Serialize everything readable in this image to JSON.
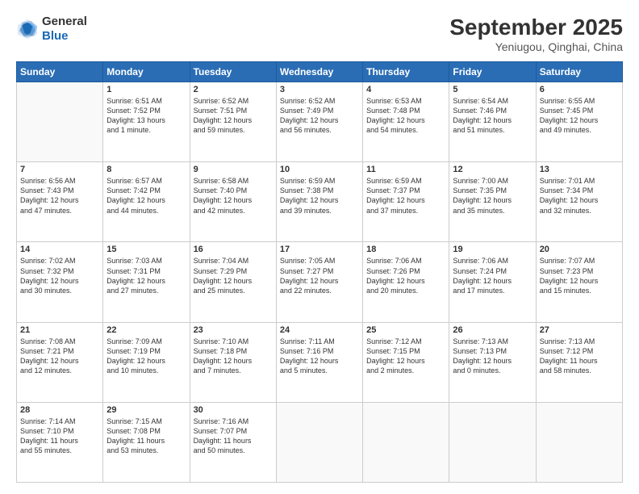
{
  "header": {
    "logo_general": "General",
    "logo_blue": "Blue",
    "month_title": "September 2025",
    "location": "Yeniugou, Qinghai, China"
  },
  "days_header": [
    "Sunday",
    "Monday",
    "Tuesday",
    "Wednesday",
    "Thursday",
    "Friday",
    "Saturday"
  ],
  "weeks": [
    [
      {
        "day": "",
        "lines": []
      },
      {
        "day": "1",
        "lines": [
          "Sunrise: 6:51 AM",
          "Sunset: 7:52 PM",
          "Daylight: 13 hours",
          "and 1 minute."
        ]
      },
      {
        "day": "2",
        "lines": [
          "Sunrise: 6:52 AM",
          "Sunset: 7:51 PM",
          "Daylight: 12 hours",
          "and 59 minutes."
        ]
      },
      {
        "day": "3",
        "lines": [
          "Sunrise: 6:52 AM",
          "Sunset: 7:49 PM",
          "Daylight: 12 hours",
          "and 56 minutes."
        ]
      },
      {
        "day": "4",
        "lines": [
          "Sunrise: 6:53 AM",
          "Sunset: 7:48 PM",
          "Daylight: 12 hours",
          "and 54 minutes."
        ]
      },
      {
        "day": "5",
        "lines": [
          "Sunrise: 6:54 AM",
          "Sunset: 7:46 PM",
          "Daylight: 12 hours",
          "and 51 minutes."
        ]
      },
      {
        "day": "6",
        "lines": [
          "Sunrise: 6:55 AM",
          "Sunset: 7:45 PM",
          "Daylight: 12 hours",
          "and 49 minutes."
        ]
      }
    ],
    [
      {
        "day": "7",
        "lines": [
          "Sunrise: 6:56 AM",
          "Sunset: 7:43 PM",
          "Daylight: 12 hours",
          "and 47 minutes."
        ]
      },
      {
        "day": "8",
        "lines": [
          "Sunrise: 6:57 AM",
          "Sunset: 7:42 PM",
          "Daylight: 12 hours",
          "and 44 minutes."
        ]
      },
      {
        "day": "9",
        "lines": [
          "Sunrise: 6:58 AM",
          "Sunset: 7:40 PM",
          "Daylight: 12 hours",
          "and 42 minutes."
        ]
      },
      {
        "day": "10",
        "lines": [
          "Sunrise: 6:59 AM",
          "Sunset: 7:38 PM",
          "Daylight: 12 hours",
          "and 39 minutes."
        ]
      },
      {
        "day": "11",
        "lines": [
          "Sunrise: 6:59 AM",
          "Sunset: 7:37 PM",
          "Daylight: 12 hours",
          "and 37 minutes."
        ]
      },
      {
        "day": "12",
        "lines": [
          "Sunrise: 7:00 AM",
          "Sunset: 7:35 PM",
          "Daylight: 12 hours",
          "and 35 minutes."
        ]
      },
      {
        "day": "13",
        "lines": [
          "Sunrise: 7:01 AM",
          "Sunset: 7:34 PM",
          "Daylight: 12 hours",
          "and 32 minutes."
        ]
      }
    ],
    [
      {
        "day": "14",
        "lines": [
          "Sunrise: 7:02 AM",
          "Sunset: 7:32 PM",
          "Daylight: 12 hours",
          "and 30 minutes."
        ]
      },
      {
        "day": "15",
        "lines": [
          "Sunrise: 7:03 AM",
          "Sunset: 7:31 PM",
          "Daylight: 12 hours",
          "and 27 minutes."
        ]
      },
      {
        "day": "16",
        "lines": [
          "Sunrise: 7:04 AM",
          "Sunset: 7:29 PM",
          "Daylight: 12 hours",
          "and 25 minutes."
        ]
      },
      {
        "day": "17",
        "lines": [
          "Sunrise: 7:05 AM",
          "Sunset: 7:27 PM",
          "Daylight: 12 hours",
          "and 22 minutes."
        ]
      },
      {
        "day": "18",
        "lines": [
          "Sunrise: 7:06 AM",
          "Sunset: 7:26 PM",
          "Daylight: 12 hours",
          "and 20 minutes."
        ]
      },
      {
        "day": "19",
        "lines": [
          "Sunrise: 7:06 AM",
          "Sunset: 7:24 PM",
          "Daylight: 12 hours",
          "and 17 minutes."
        ]
      },
      {
        "day": "20",
        "lines": [
          "Sunrise: 7:07 AM",
          "Sunset: 7:23 PM",
          "Daylight: 12 hours",
          "and 15 minutes."
        ]
      }
    ],
    [
      {
        "day": "21",
        "lines": [
          "Sunrise: 7:08 AM",
          "Sunset: 7:21 PM",
          "Daylight: 12 hours",
          "and 12 minutes."
        ]
      },
      {
        "day": "22",
        "lines": [
          "Sunrise: 7:09 AM",
          "Sunset: 7:19 PM",
          "Daylight: 12 hours",
          "and 10 minutes."
        ]
      },
      {
        "day": "23",
        "lines": [
          "Sunrise: 7:10 AM",
          "Sunset: 7:18 PM",
          "Daylight: 12 hours",
          "and 7 minutes."
        ]
      },
      {
        "day": "24",
        "lines": [
          "Sunrise: 7:11 AM",
          "Sunset: 7:16 PM",
          "Daylight: 12 hours",
          "and 5 minutes."
        ]
      },
      {
        "day": "25",
        "lines": [
          "Sunrise: 7:12 AM",
          "Sunset: 7:15 PM",
          "Daylight: 12 hours",
          "and 2 minutes."
        ]
      },
      {
        "day": "26",
        "lines": [
          "Sunrise: 7:13 AM",
          "Sunset: 7:13 PM",
          "Daylight: 12 hours",
          "and 0 minutes."
        ]
      },
      {
        "day": "27",
        "lines": [
          "Sunrise: 7:13 AM",
          "Sunset: 7:12 PM",
          "Daylight: 11 hours",
          "and 58 minutes."
        ]
      }
    ],
    [
      {
        "day": "28",
        "lines": [
          "Sunrise: 7:14 AM",
          "Sunset: 7:10 PM",
          "Daylight: 11 hours",
          "and 55 minutes."
        ]
      },
      {
        "day": "29",
        "lines": [
          "Sunrise: 7:15 AM",
          "Sunset: 7:08 PM",
          "Daylight: 11 hours",
          "and 53 minutes."
        ]
      },
      {
        "day": "30",
        "lines": [
          "Sunrise: 7:16 AM",
          "Sunset: 7:07 PM",
          "Daylight: 11 hours",
          "and 50 minutes."
        ]
      },
      {
        "day": "",
        "lines": []
      },
      {
        "day": "",
        "lines": []
      },
      {
        "day": "",
        "lines": []
      },
      {
        "day": "",
        "lines": []
      }
    ]
  ]
}
